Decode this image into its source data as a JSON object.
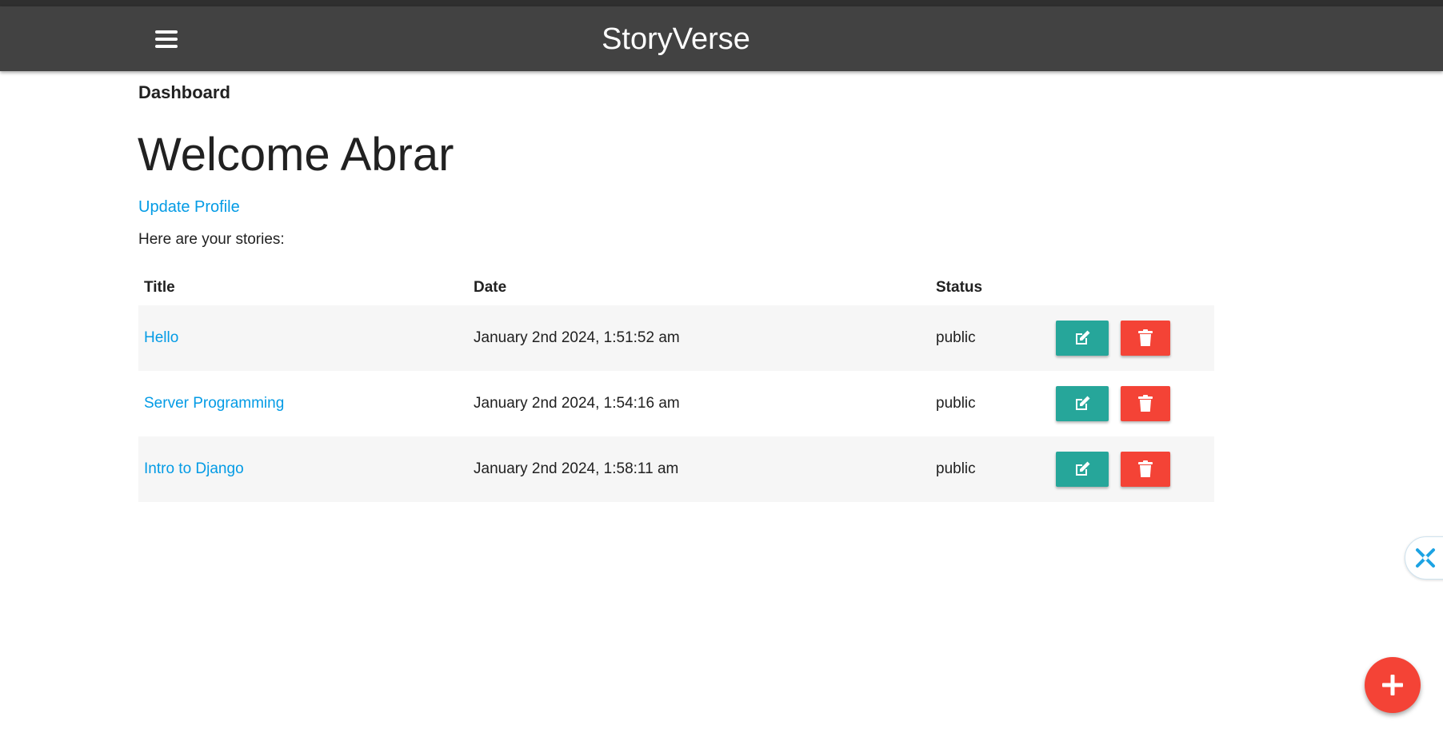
{
  "app": {
    "brand": "StoryVerse"
  },
  "header": {
    "menu_icon": "hamburger-menu-icon"
  },
  "breadcrumb": "Dashboard",
  "welcome": "Welcome Abrar",
  "update_profile": "Update Profile",
  "intro": "Here are your stories:",
  "table": {
    "headers": {
      "title": "Title",
      "date": "Date",
      "status": "Status"
    },
    "rows": [
      {
        "title": "Hello",
        "date": "January 2nd 2024, 1:51:52 am",
        "status": "public"
      },
      {
        "title": "Server Programming",
        "date": "January 2nd 2024, 1:54:16 am",
        "status": "public"
      },
      {
        "title": "Intro to Django",
        "date": "January 2nd 2024, 1:58:11 am",
        "status": "public"
      }
    ],
    "edit_icon": "edit-pencil-icon",
    "delete_icon": "trash-icon"
  },
  "fab": {
    "icon": "plus-icon"
  },
  "colors": {
    "navbar": "#424242",
    "link": "#039be5",
    "edit_button": "#26a69a",
    "delete_button": "#f44336",
    "fab": "#f44336"
  }
}
